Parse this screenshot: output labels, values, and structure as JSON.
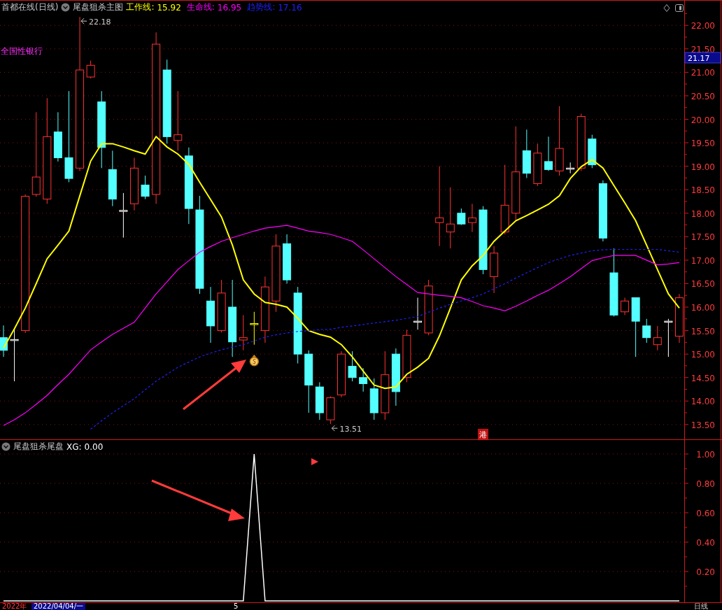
{
  "header": {
    "title": "首都在线(日线)",
    "indicator": "尾盘狙杀主图",
    "legend": [
      {
        "value": "15.92"
      },
      {
        "value": "16.95"
      },
      {
        "value": "17.16"
      }
    ]
  },
  "sector_label": "全国性银行",
  "price_tag": "21.17",
  "hk_badge": "港",
  "main_chart": {
    "chart_data": {
      "type": "candlestick",
      "grid": true,
      "ylim": [
        13.17,
        22.54
      ],
      "yticks": [
        {
          "value": 13.5,
          "label": "13.50"
        },
        {
          "value": 14,
          "label": "14.00"
        },
        {
          "value": 14.5,
          "label": "14.50"
        },
        {
          "value": 15,
          "label": "15.00"
        },
        {
          "value": 15.5,
          "label": "15.50"
        },
        {
          "value": 16,
          "label": "16.00"
        },
        {
          "value": 16.5,
          "label": "16.50"
        },
        {
          "value": 17,
          "label": "17.00"
        },
        {
          "value": 17.5,
          "label": "17.50"
        },
        {
          "value": 18,
          "label": "18.00"
        },
        {
          "value": 18.5,
          "label": "18.50"
        },
        {
          "value": 19,
          "label": "19.00"
        },
        {
          "value": 19.5,
          "label": "19.50"
        },
        {
          "value": 20,
          "label": "20.00"
        },
        {
          "value": 20.5,
          "label": "20.50"
        },
        {
          "value": 21,
          "label": "21.00"
        },
        {
          "value": 21.5,
          "label": "21.50"
        },
        {
          "value": 22,
          "label": "22.00"
        }
      ],
      "ohlc": [
        [
          15.35,
          15.61,
          14.94,
          15.08
        ],
        [
          15.31,
          15.54,
          14.42,
          15.31
        ],
        [
          15.5,
          18.4,
          15.45,
          18.36
        ],
        [
          18.4,
          20.15,
          18.35,
          18.77
        ],
        [
          18.3,
          20.45,
          18.2,
          19.63
        ],
        [
          19.73,
          20.15,
          19.1,
          19.18
        ],
        [
          19.18,
          20.6,
          18.66,
          18.74
        ],
        [
          18.96,
          22.18,
          18.9,
          21.05
        ],
        [
          20.9,
          21.25,
          20.87,
          21.15
        ],
        [
          20.37,
          20.6,
          18.96,
          19.4
        ],
        [
          18.93,
          19.33,
          18.15,
          18.3
        ],
        [
          18.06,
          18.43,
          17.48,
          18.06
        ],
        [
          18.2,
          19.18,
          18.06,
          18.96
        ],
        [
          18.6,
          18.8,
          18.3,
          18.36
        ],
        [
          18.4,
          21.85,
          18.2,
          21.6
        ],
        [
          21.05,
          21.27,
          19.48,
          19.63
        ],
        [
          19.55,
          20.6,
          19.33,
          19.67
        ],
        [
          19.22,
          19.4,
          17.77,
          18.1
        ],
        [
          18.07,
          18.37,
          16.28,
          16.4
        ],
        [
          16.13,
          16.43,
          15.24,
          15.6
        ],
        [
          15.5,
          16.58,
          15.46,
          16.3
        ],
        [
          16.0,
          16.58,
          14.94,
          15.26
        ],
        [
          15.3,
          15.83,
          15.08,
          15.35
        ],
        [
          15.65,
          15.9,
          15.2,
          15.65
        ],
        [
          15.5,
          16.65,
          15.24,
          16.43
        ],
        [
          16.13,
          17.55,
          15.9,
          17.3
        ],
        [
          17.35,
          17.55,
          16.5,
          16.58
        ],
        [
          16.3,
          16.43,
          14.8,
          15.0
        ],
        [
          15.0,
          15.08,
          13.75,
          14.34
        ],
        [
          14.3,
          14.4,
          13.6,
          13.75
        ],
        [
          13.6,
          14.1,
          13.51,
          14.07
        ],
        [
          14.13,
          15.06,
          14.08,
          15.0
        ],
        [
          14.74,
          15.06,
          14.42,
          14.5
        ],
        [
          14.5,
          14.7,
          14.2,
          14.37
        ],
        [
          14.26,
          14.48,
          13.6,
          13.75
        ],
        [
          13.75,
          15.06,
          13.6,
          14.56
        ],
        [
          15.0,
          15.12,
          13.9,
          14.2
        ],
        [
          14.5,
          15.52,
          14.4,
          15.4
        ],
        [
          15.7,
          16.2,
          15.52,
          15.7
        ],
        [
          15.45,
          16.58,
          15.4,
          16.45
        ],
        [
          17.8,
          19.0,
          17.3,
          17.9
        ],
        [
          17.6,
          18.55,
          17.25,
          17.77
        ],
        [
          18.0,
          18.1,
          17.75,
          17.77
        ],
        [
          17.8,
          18.2,
          17.6,
          17.9
        ],
        [
          18.07,
          18.15,
          16.7,
          16.8
        ],
        [
          16.65,
          17.3,
          16.3,
          17.15
        ],
        [
          17.6,
          19.03,
          17.55,
          18.17
        ],
        [
          18.0,
          19.85,
          17.85,
          18.88
        ],
        [
          19.33,
          19.78,
          18.75,
          18.85
        ],
        [
          18.63,
          19.48,
          18.58,
          19.28
        ],
        [
          19.1,
          19.63,
          18.9,
          18.93
        ],
        [
          18.9,
          20.28,
          18.8,
          19.38
        ],
        [
          18.96,
          19.08,
          18.85,
          18.96
        ],
        [
          18.96,
          20.12,
          18.9,
          20.06
        ],
        [
          19.58,
          19.67,
          18.96,
          19.03
        ],
        [
          18.63,
          18.7,
          17.4,
          17.47
        ],
        [
          16.73,
          17.25,
          15.8,
          15.83
        ],
        [
          15.9,
          16.2,
          15.83,
          16.13
        ],
        [
          16.2,
          16.2,
          14.94,
          15.7
        ],
        [
          15.6,
          15.75,
          15.24,
          15.35
        ],
        [
          15.2,
          15.6,
          15.08,
          15.35
        ],
        [
          15.7,
          15.75,
          14.94,
          15.7
        ],
        [
          15.38,
          16.28,
          15.24,
          16.2
        ]
      ],
      "series": [
        {
          "name": "工作线:",
          "type": "line",
          "color": "#ffff00",
          "line_style": "solid",
          "values": [
            15.13,
            15.54,
            15.98,
            16.5,
            17.03,
            17.32,
            17.62,
            18.37,
            19.11,
            19.48,
            19.48,
            19.41,
            19.33,
            19.26,
            19.63,
            19.41,
            19.26,
            19.04,
            18.66,
            18.29,
            17.92,
            17.32,
            16.58,
            16.28,
            16.1,
            16.06,
            16.0,
            15.76,
            15.5,
            15.42,
            15.36,
            15.2,
            14.94,
            14.64,
            14.34,
            14.27,
            14.3,
            14.57,
            14.72,
            14.91,
            15.39,
            15.98,
            16.58,
            16.88,
            17.1,
            17.4,
            17.62,
            17.84,
            17.95,
            18.07,
            18.19,
            18.37,
            18.74,
            18.99,
            19.14,
            18.96,
            18.59,
            18.22,
            17.84,
            17.32,
            16.8,
            16.28,
            15.98
          ]
        },
        {
          "name": "生命线:",
          "type": "line",
          "color": "#ff00ff",
          "line_style": "solid",
          "values": [
            13.48,
            13.6,
            13.75,
            13.93,
            14.12,
            14.35,
            14.57,
            14.83,
            15.09,
            15.26,
            15.42,
            15.55,
            15.68,
            15.98,
            16.28,
            16.54,
            16.8,
            16.99,
            17.17,
            17.29,
            17.4,
            17.48,
            17.55,
            17.62,
            17.68,
            17.71,
            17.74,
            17.68,
            17.62,
            17.59,
            17.55,
            17.48,
            17.4,
            17.22,
            17.03,
            16.84,
            16.65,
            16.48,
            16.31,
            16.28,
            16.25,
            16.23,
            16.2,
            16.12,
            16.03,
            15.98,
            15.92,
            16.02,
            16.13,
            16.25,
            16.36,
            16.5,
            16.65,
            16.82,
            16.99,
            17.05,
            17.1,
            17.1,
            17.1,
            17.0,
            16.9,
            16.92,
            16.95
          ]
        },
        {
          "name": "趋势线:",
          "type": "line",
          "color": "#2020ff",
          "line_style": "dashed",
          "values": [
            null,
            null,
            null,
            null,
            null,
            null,
            null,
            null,
            13.4,
            13.58,
            13.75,
            13.9,
            14.05,
            14.24,
            14.42,
            14.57,
            14.72,
            14.83,
            14.94,
            15.02,
            15.09,
            15.15,
            15.2,
            15.28,
            15.36,
            15.41,
            15.45,
            15.48,
            15.5,
            15.52,
            15.53,
            15.57,
            15.6,
            15.63,
            15.66,
            15.69,
            15.72,
            15.76,
            15.8,
            15.89,
            15.98,
            16.06,
            16.13,
            16.2,
            16.28,
            16.39,
            16.5,
            16.62,
            16.73,
            16.84,
            16.95,
            17.03,
            17.1,
            17.15,
            17.2,
            17.22,
            17.23,
            17.23,
            17.23,
            17.23,
            17.23,
            17.2,
            17.17
          ]
        }
      ],
      "annotations": [
        {
          "text": "22.18"
        },
        {
          "text": "13.51"
        }
      ]
    }
  },
  "lower_pane": {
    "title": "尾盘狙杀尾盘",
    "reading": "0.00",
    "chart_data": {
      "type": "line",
      "grid": true,
      "ylim": [
        0,
        1
      ],
      "yticks": [
        {
          "value": 0.2,
          "label": "0.20"
        },
        {
          "value": 0.4,
          "label": "0.40"
        },
        {
          "value": 0.6,
          "label": "0.60"
        },
        {
          "value": 0.8,
          "label": "0.80"
        },
        {
          "value": 1,
          "label": "1.00"
        }
      ],
      "series": [
        {
          "name": "XG:",
          "color": "#ffffff",
          "values": [
            0,
            0,
            0,
            0,
            0,
            0,
            0,
            0,
            0,
            0,
            0,
            0,
            0,
            0,
            0,
            0,
            0,
            0,
            0,
            0,
            0,
            0,
            0,
            1,
            0,
            0,
            0,
            0,
            0,
            0,
            0,
            0,
            0,
            0,
            0,
            0,
            0,
            0,
            0,
            0,
            0,
            0,
            0,
            0,
            0,
            0,
            0,
            0,
            0,
            0,
            0,
            0,
            0,
            0,
            0,
            0,
            0,
            0,
            0,
            0,
            0,
            0,
            0
          ]
        }
      ]
    }
  },
  "time_axis": {
    "year": "2022年",
    "cursor_date": "2022/04/04/一",
    "month_label": "5",
    "period": "日线"
  }
}
